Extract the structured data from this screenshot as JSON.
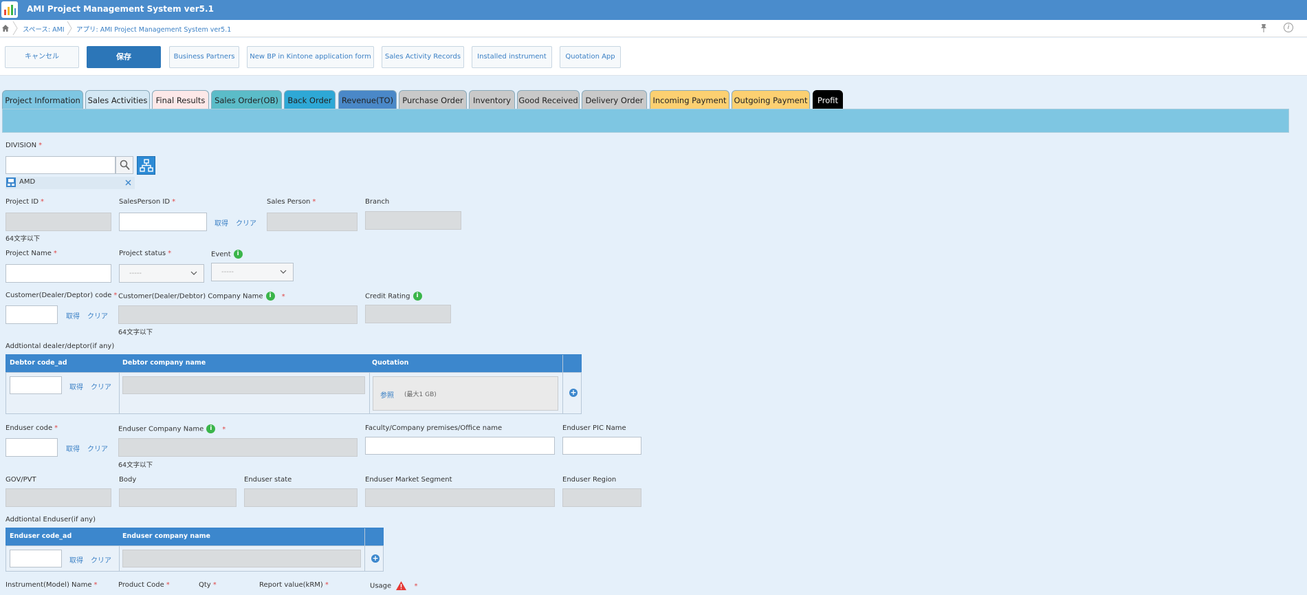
{
  "header": {
    "title": "AMI Project Management System ver5.1"
  },
  "breadcrumb": {
    "space": "スペース: AMI",
    "app": "アプリ: AMI Project Management System ver5.1",
    "info_glyph": "i"
  },
  "toolbar": {
    "cancel": "キャンセル",
    "save": "保存",
    "links": [
      "Business Partners",
      "New BP in Kintone application form",
      "Sales Activity Records",
      "Installed instrument",
      "Quotation App"
    ]
  },
  "tabs": [
    {
      "label": "Project Information",
      "bg": "#7ec6e2"
    },
    {
      "label": "Sales Activities",
      "bg": "#d4e8f4"
    },
    {
      "label": "Final Results",
      "bg": "#fde8e8"
    },
    {
      "label": "Sales Order(OB)",
      "bg": "#5bbcc8"
    },
    {
      "label": "Back Order",
      "bg": "#2ea8d6"
    },
    {
      "label": "Revenue(TO)",
      "bg": "#4a88c8"
    },
    {
      "label": "Purchase Order",
      "bg": "#c9c9c9"
    },
    {
      "label": "Inventory",
      "bg": "#c9c9c9"
    },
    {
      "label": "Good Received",
      "bg": "#c9c9c9"
    },
    {
      "label": "Delivery Order",
      "bg": "#c9c9c9"
    },
    {
      "label": "Incoming Payment",
      "bg": "#fcd071"
    },
    {
      "label": "Outgoing Payment",
      "bg": "#fcd071"
    },
    {
      "label": "Profit",
      "bg": "#000000"
    }
  ],
  "form": {
    "division_label": "DIVISION",
    "division_value": "AMD",
    "required_mark": "*",
    "project_id_label": "Project ID",
    "salesperson_id_label": "SalesPerson ID",
    "sales_person_label": "Sales Person",
    "branch_label": "Branch",
    "get_link": "取得",
    "clear_link": "クリア",
    "max64": "64文字以下",
    "project_name_label": "Project Name",
    "project_status_label": "Project status",
    "event_label": "Event",
    "select_placeholder": "-----",
    "customer_code_label": "Customer(Dealer/Deptor) code",
    "customer_company_label": "Customer(Dealer/Debtor) Company Name",
    "credit_rating_label": "Credit Rating",
    "info_glyph": "i",
    "additional_dealer_label": "Addtiontal dealer/deptor(if any)",
    "debtor_table": {
      "headers": [
        "Debtor code_ad",
        "Debtor company name",
        "Quotation"
      ],
      "browse": "参照",
      "max_size": "(最大1 GB)"
    },
    "enduser_code_label": "Enduser code",
    "enduser_company_label": "Enduser Company Name",
    "faculty_label": "Faculty/Company premises/Office name",
    "enduser_pic_label": "Enduser PIC Name",
    "gov_label": "GOV/PVT",
    "body_label": "Body",
    "enduser_state_label": "Enduser state",
    "market_segment_label": "Enduser Market Segment",
    "region_label": "Enduser Region",
    "additional_enduser_label": "Addtiontal Enduser(if any)",
    "enduser_table": {
      "headers": [
        "Enduser code_ad",
        "Enduser company name"
      ]
    },
    "instrument_label": "Instrument(Model) Name",
    "product_code_label": "Product Code",
    "qty_label": "Qty",
    "report_value_label": "Report value(kRM)",
    "usage_label": "Usage"
  }
}
